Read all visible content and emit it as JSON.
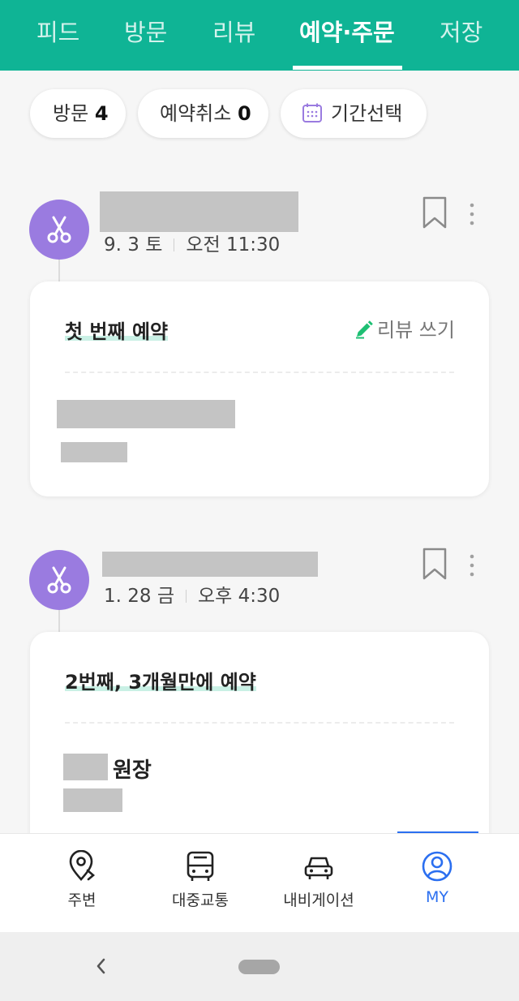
{
  "tabs": [
    {
      "label": "피드"
    },
    {
      "label": "방문"
    },
    {
      "label": "리뷰"
    },
    {
      "label": "예약·주문",
      "active": true
    },
    {
      "label": "저장"
    }
  ],
  "filters": {
    "visit_label": "방문",
    "visit_count": "4",
    "cancel_label": "예약취소",
    "cancel_count": "0",
    "period_label": "기간선택"
  },
  "entries": [
    {
      "icon": "scissors-icon",
      "date": "9. 3 토",
      "time": "오전 11:30",
      "card_title": "첫 번째 예약",
      "review_label": "리뷰 쓰기"
    },
    {
      "icon": "scissors-icon",
      "date": "1. 28 금",
      "time": "오후 4:30",
      "card_title": "2번째, 3개월만에 예약",
      "director_label": "원장"
    }
  ],
  "bottom_nav": [
    {
      "label": "주변",
      "icon": "location-pin-icon"
    },
    {
      "label": "대중교통",
      "icon": "bus-icon"
    },
    {
      "label": "내비게이션",
      "icon": "car-icon"
    },
    {
      "label": "MY",
      "icon": "profile-icon",
      "active": true
    }
  ],
  "colors": {
    "brand_green": "#0fb495",
    "avatar_purple": "#9a7be0",
    "active_blue": "#2b6ff0",
    "pencil_green": "#1dbf73"
  }
}
